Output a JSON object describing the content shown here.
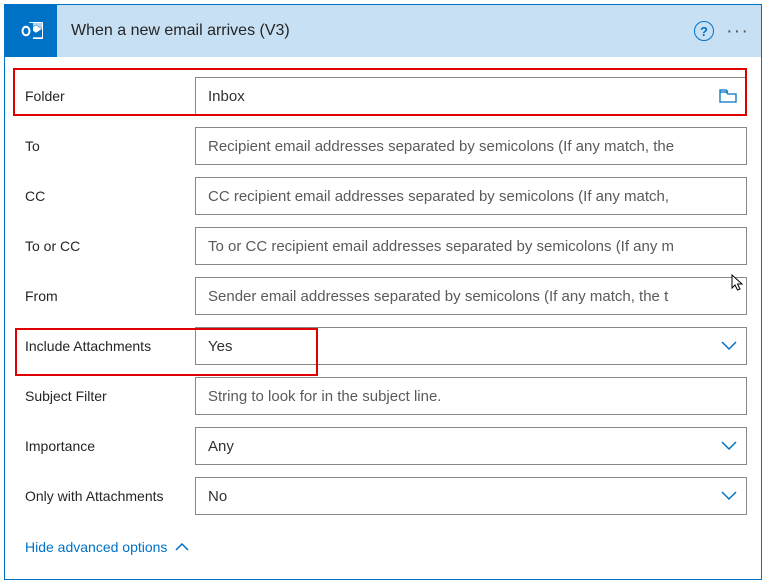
{
  "header": {
    "title": "When a new email arrives (V3)"
  },
  "fields": {
    "folder": {
      "label": "Folder",
      "value": "Inbox"
    },
    "to": {
      "label": "To",
      "placeholder": "Recipient email addresses separated by semicolons (If any match, the"
    },
    "cc": {
      "label": "CC",
      "placeholder": "CC recipient email addresses separated by semicolons (If any match,"
    },
    "toOrCc": {
      "label": "To or CC",
      "placeholder": "To or CC recipient email addresses separated by semicolons (If any m"
    },
    "from": {
      "label": "From",
      "placeholder": "Sender email addresses separated by semicolons (If any match, the t"
    },
    "includeAttachments": {
      "label": "Include Attachments",
      "value": "Yes"
    },
    "subjectFilter": {
      "label": "Subject Filter",
      "placeholder": "String to look for in the subject line."
    },
    "importance": {
      "label": "Importance",
      "value": "Any"
    },
    "onlyWithAttachments": {
      "label": "Only with Attachments",
      "value": "No"
    }
  },
  "advanced": {
    "label": "Hide advanced options"
  }
}
